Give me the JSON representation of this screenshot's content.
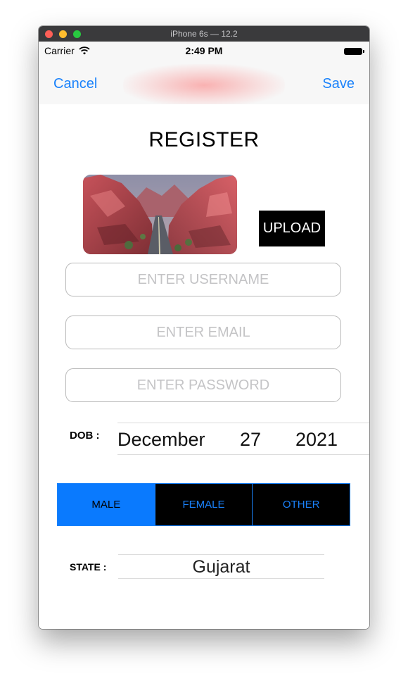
{
  "window": {
    "title": "iPhone 6s — 12.2"
  },
  "status_bar": {
    "carrier": "Carrier",
    "time": "2:49 PM"
  },
  "nav": {
    "cancel_label": "Cancel",
    "save_label": "Save"
  },
  "form": {
    "title": "REGISTER",
    "upload_label": "UPLOAD",
    "username_placeholder": "ENTER USERNAME",
    "email_placeholder": "ENTER EMAIL",
    "password_placeholder": "ENTER PASSWORD",
    "dob_label": "DOB :",
    "dob": {
      "month": "December",
      "day": "27",
      "year": "2021"
    },
    "gender_options": [
      "MALE",
      "FEMALE",
      "OTHER"
    ],
    "gender_selected": "MALE",
    "state_label": "STATE :",
    "state_value": "Gujarat"
  },
  "colors": {
    "accent": "#1a82fb",
    "selected_segment": "#0a7afe",
    "upload_bg": "#000000"
  },
  "icons": {
    "wifi": "wifi-icon",
    "battery": "battery-icon"
  }
}
